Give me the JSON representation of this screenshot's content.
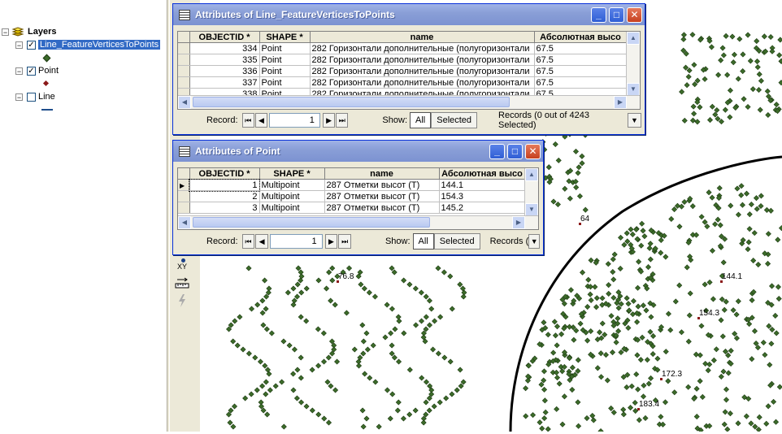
{
  "toc": {
    "root_label": "Layers",
    "layers": [
      {
        "label": "Line_FeatureVerticesToPoints",
        "checked": true,
        "selected": true
      },
      {
        "label": "Point",
        "checked": true,
        "selected": false
      },
      {
        "label": "Line",
        "checked": false,
        "selected": false
      }
    ],
    "expander_minus": "−",
    "check_mark": "✓"
  },
  "map": {
    "labels": [
      "76.8",
      "64",
      "144.1",
      "154.3",
      "172.3",
      "183.4"
    ],
    "tools": {
      "xy": "XY"
    },
    "colors": {
      "point_fill": "#3c6b2a",
      "point_stroke": "#1d3a12",
      "ring": "#000000",
      "label_marker": "#8b1a1a"
    }
  },
  "window1": {
    "title": "Attributes of Line_FeatureVerticesToPoints",
    "columns": [
      "OBJECTID *",
      "SHAPE *",
      "name",
      "Абсолютная высо"
    ],
    "rows": [
      [
        "334",
        "Point",
        "282 Горизонтали дополнительные (полугоризонтали",
        "67.5"
      ],
      [
        "335",
        "Point",
        "282 Горизонтали дополнительные (полугоризонтали",
        "67.5"
      ],
      [
        "336",
        "Point",
        "282 Горизонтали дополнительные (полугоризонтали",
        "67.5"
      ],
      [
        "337",
        "Point",
        "282 Горизонтали дополнительные (полугоризонтали",
        "67.5"
      ],
      [
        "338",
        "Point",
        "282 Горизонтали дополнительные (полугоризонтали",
        "67.5"
      ]
    ],
    "record_label": "Record:",
    "record_value": "1",
    "show_label": "Show:",
    "all_label": "All",
    "selected_label": "Selected",
    "records_text": "Records (0 out of 4243 Selected)"
  },
  "window2": {
    "title": "Attributes of Point",
    "columns": [
      "OBJECTID *",
      "SHAPE *",
      "name",
      "Абсолютная высо"
    ],
    "rows": [
      [
        "1",
        "Multipoint",
        "287 Отметки высот (Т)",
        "144.1"
      ],
      [
        "2",
        "Multipoint",
        "287 Отметки высот (Т)",
        "154.3"
      ],
      [
        "3",
        "Multipoint",
        "287 Отметки высот (Т)",
        "145.2"
      ]
    ],
    "record_label": "Record:",
    "record_value": "1",
    "show_label": "Show:",
    "all_label": "All",
    "selected_label": "Selected",
    "records_text": "Records ("
  },
  "icons": {
    "first": "⏮",
    "prev": "◀",
    "next": "▶",
    "last": "⏭",
    "minimize": "_",
    "maximize": "□",
    "close": "✕",
    "up": "▲",
    "down": "▼",
    "left": "◀",
    "right": "▶",
    "menu": "▼"
  }
}
